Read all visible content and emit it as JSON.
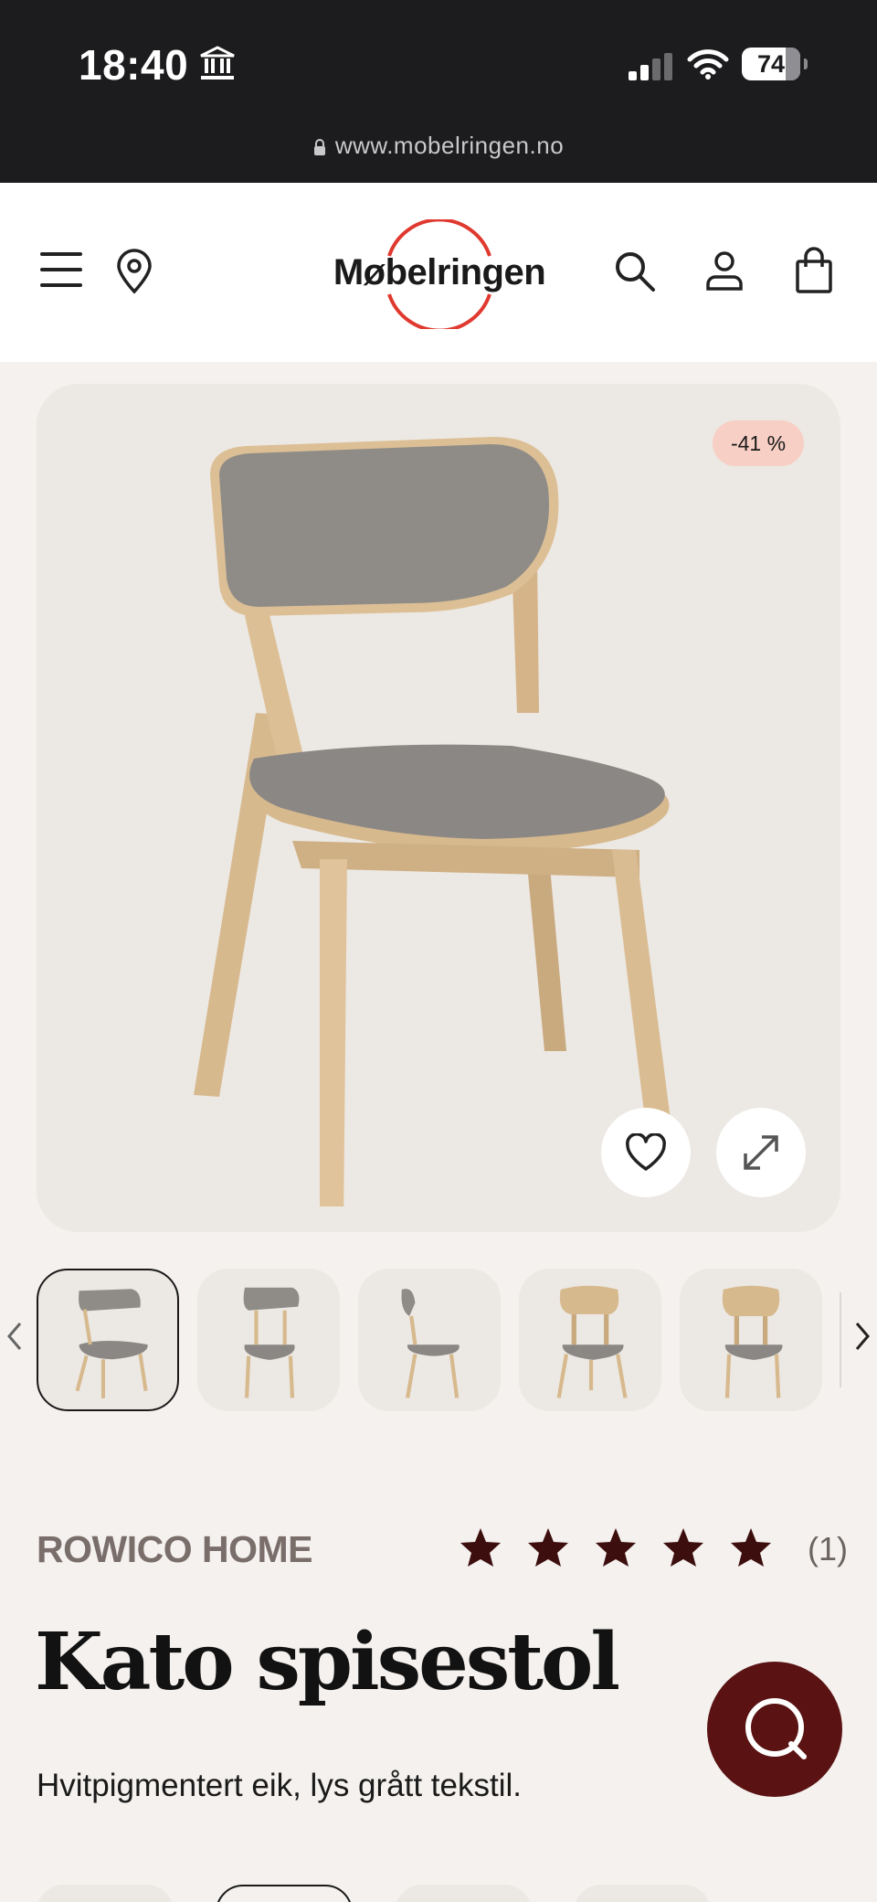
{
  "status_bar": {
    "time": "18:40",
    "battery": "74",
    "url": "www.mobelringen.no"
  },
  "header": {
    "logo_text": "Møbelringen",
    "icons": [
      "menu-icon",
      "location-pin-icon",
      "search-icon",
      "user-icon",
      "shopping-bag-icon"
    ]
  },
  "product": {
    "discount_badge": "-41 %",
    "brand": "ROWICO HOME",
    "rating": 5,
    "review_count": "(1)",
    "title": "Kato spisestol",
    "description": "Hvitpigmentert eik, lys grått tekstil.",
    "thumbnail_count": 5,
    "selected_thumbnail": 0
  },
  "colors": {
    "accent_dark_red": "#5a1212",
    "star_color": "#3d0e0e",
    "badge_bg": "#f7cfc4",
    "logo_ring": "#e0392f"
  }
}
